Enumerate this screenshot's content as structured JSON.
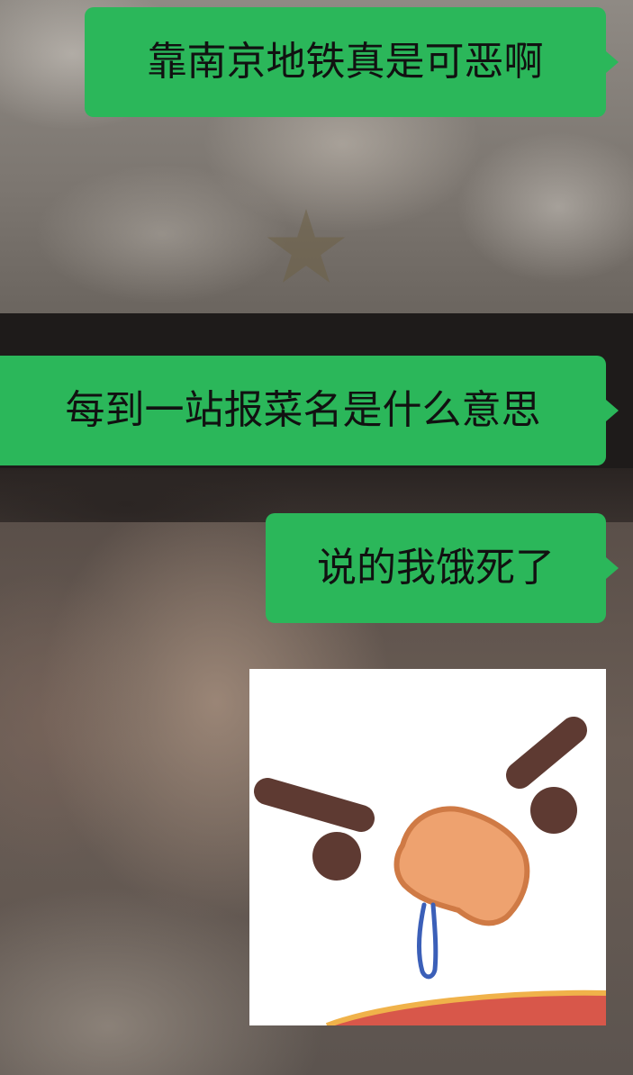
{
  "chat": {
    "messages": [
      {
        "sender": "self",
        "type": "text",
        "text": "靠南京地铁真是可恶啊"
      },
      {
        "sender": "self",
        "type": "text",
        "text": "每到一站报菜名是什么意思"
      },
      {
        "sender": "self",
        "type": "text",
        "text": "说的我饿死了"
      },
      {
        "sender": "self",
        "type": "sticker",
        "sticker": "angry-drooling-duck-sticker"
      }
    ]
  },
  "colors": {
    "bubble_self": "#2bb75a",
    "text": "#111111"
  }
}
